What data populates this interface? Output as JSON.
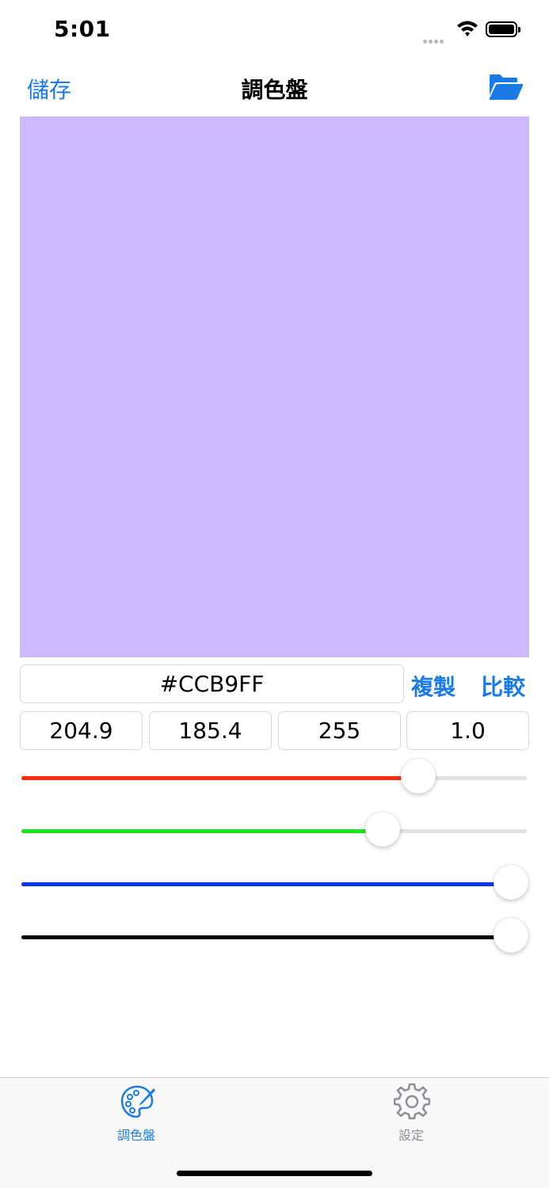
{
  "status_bar": {
    "time": "5:01"
  },
  "nav": {
    "save_label": "儲存",
    "title": "調色盤",
    "open_icon": "folder-open-icon"
  },
  "colors": {
    "accent": "#1a7be6",
    "swatch": "#CCB9FF",
    "red": "#ff2a0c",
    "green": "#19e619",
    "blue": "#0a38e6",
    "alpha": "#000000"
  },
  "color_editor": {
    "hex_value": "#CCB9FF",
    "copy_label": "複製",
    "compare_label": "比較",
    "components": {
      "red": "204.9",
      "green": "185.4",
      "blue": "255",
      "alpha": "1.0"
    }
  },
  "sliders": {
    "red_level": 0.8,
    "green_level": 0.72,
    "blue_level": 1.0,
    "alpha_level": 1.0
  },
  "tabs": [
    {
      "label": "調色盤",
      "icon": "palette-icon",
      "selected": true
    },
    {
      "label": "設定",
      "icon": "gear-icon",
      "selected": false
    }
  ]
}
